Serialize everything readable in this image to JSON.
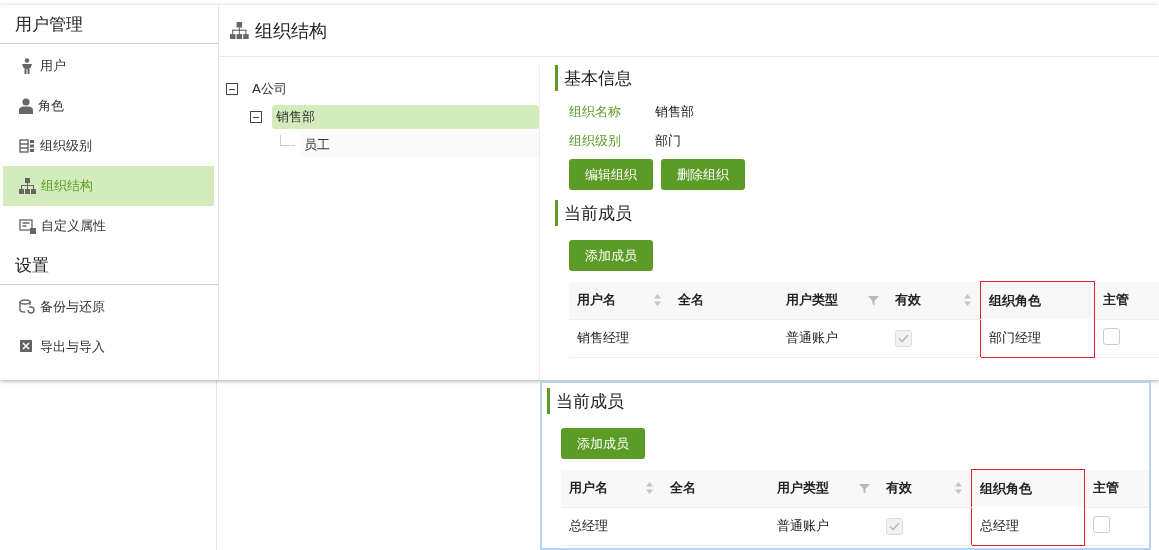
{
  "sidebar": {
    "sections": [
      {
        "title": "用户管理",
        "items": [
          {
            "label": "用户",
            "selected": false
          },
          {
            "label": "角色",
            "selected": false
          },
          {
            "label": "组织级别",
            "selected": false
          },
          {
            "label": "组织结构",
            "selected": true
          },
          {
            "label": "自定义属性",
            "selected": false
          }
        ]
      },
      {
        "title": "设置",
        "items": [
          {
            "label": "备份与还原",
            "selected": false
          },
          {
            "label": "导出与导入",
            "selected": false
          }
        ]
      }
    ]
  },
  "page_title": "组织结构",
  "tree": [
    {
      "label": "A公司",
      "expanded": true,
      "selected": false,
      "children": [
        {
          "label": "销售部",
          "expanded": true,
          "selected": true,
          "children": [
            {
              "label": "员工",
              "selected": false
            }
          ]
        }
      ]
    }
  ],
  "basic_info": {
    "heading": "基本信息",
    "fields": [
      {
        "label": "组织名称",
        "value": "销售部"
      },
      {
        "label": "组织级别",
        "value": "部门"
      }
    ],
    "buttons": [
      "编辑组织",
      "删除组织"
    ]
  },
  "members": {
    "heading": "当前成员",
    "add_button": "添加成员",
    "columns": [
      {
        "label": "用户名",
        "kind": "sort",
        "highlighted": false
      },
      {
        "label": "全名",
        "kind": "plain",
        "highlighted": false
      },
      {
        "label": "用户类型",
        "kind": "filter",
        "highlighted": false
      },
      {
        "label": "有效",
        "kind": "sort",
        "highlighted": false
      },
      {
        "label": "组织角色",
        "kind": "plain",
        "highlighted": true
      },
      {
        "label": "主管",
        "kind": "plain",
        "highlighted": false
      }
    ],
    "rows": [
      {
        "username": "销售经理",
        "fullname": "",
        "user_type": "普通账户",
        "valid": {
          "checked": true,
          "disabled": true
        },
        "org_role": "部门经理",
        "manager": {
          "checked": false,
          "disabled": false
        }
      }
    ]
  },
  "overlay_members": {
    "heading": "当前成员",
    "add_button": "添加成员",
    "columns": [
      {
        "label": "用户名",
        "kind": "sort",
        "highlighted": false
      },
      {
        "label": "全名",
        "kind": "plain",
        "highlighted": false
      },
      {
        "label": "用户类型",
        "kind": "filter",
        "highlighted": false
      },
      {
        "label": "有效",
        "kind": "sort",
        "highlighted": false
      },
      {
        "label": "组织角色",
        "kind": "plain",
        "highlighted": true
      },
      {
        "label": "主管",
        "kind": "plain",
        "highlighted": false
      }
    ],
    "rows": [
      {
        "username": "总经理",
        "fullname": "",
        "user_type": "普通账户",
        "valid": {
          "checked": true,
          "disabled": true
        },
        "org_role": "总经理",
        "manager": {
          "checked": false,
          "disabled": false
        }
      }
    ]
  }
}
